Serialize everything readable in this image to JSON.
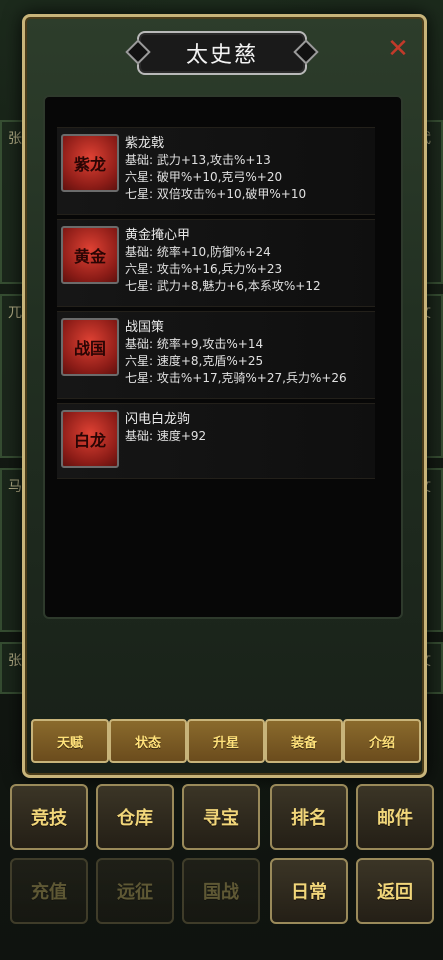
{
  "hero": {
    "name": "太史慈"
  },
  "items": [
    {
      "name": "紫龙戟",
      "icon_text": "紫龙",
      "attributes": [
        {
          "label": "基础: ",
          "value": "武力+13,攻击%+13"
        },
        {
          "label": "六星: ",
          "value": "破甲%+10,克弓%+20"
        },
        {
          "label": "七星: ",
          "value": "双倍攻击%+10,破甲%+10"
        }
      ]
    },
    {
      "name": "黄金掩心甲",
      "icon_text": "黄金",
      "attributes": [
        {
          "label": "基础: ",
          "value": "统率+10,防御%+24"
        },
        {
          "label": "六星: ",
          "value": "攻击%+16,兵力%+23"
        },
        {
          "label": "七星: ",
          "value": "武力+8,魅力+6,本系攻%+12"
        }
      ]
    },
    {
      "name": "战国策",
      "icon_text": "战国",
      "attributes": [
        {
          "label": "基础: ",
          "value": "统率+9,攻击%+14"
        },
        {
          "label": "六星: ",
          "value": "速度+8,克盾%+25"
        },
        {
          "label": "七星: ",
          "value": "攻击%+17,克骑%+27,兵力%+26"
        }
      ]
    },
    {
      "name": "闪电白龙驹",
      "icon_text": "白龙",
      "attributes": [
        {
          "label": "基础: ",
          "value": "速度+92"
        }
      ]
    }
  ],
  "tabs": [
    "天赋",
    "状态",
    "升星",
    "装备",
    "介绍"
  ],
  "bottom_menu": [
    {
      "label": "竞技",
      "enabled": true
    },
    {
      "label": "仓库",
      "enabled": true
    },
    {
      "label": "寻宝",
      "enabled": true
    },
    {
      "label": "排名",
      "enabled": true
    },
    {
      "label": "邮件",
      "enabled": true
    },
    {
      "label": "充值",
      "enabled": false
    },
    {
      "label": "远征",
      "enabled": false
    },
    {
      "label": "国战",
      "enabled": false
    },
    {
      "label": "日常",
      "enabled": true
    },
    {
      "label": "返回",
      "enabled": true
    }
  ],
  "side_cards": {
    "left": [
      {
        "char": "张"
      },
      {
        "char": "兀"
      },
      {
        "char": "马"
      },
      {
        "char": "张"
      }
    ],
    "right": [
      {
        "char": "武"
      },
      {
        "char": "文"
      },
      {
        "char": "文"
      },
      {
        "char": "文"
      }
    ]
  },
  "colors": {
    "accent_gold": "#c8b47a",
    "title_text": "#f2f2f2",
    "tab_text": "#ffe17a",
    "item_icon_red": "#e04234",
    "close_red": "#c23a2a"
  }
}
